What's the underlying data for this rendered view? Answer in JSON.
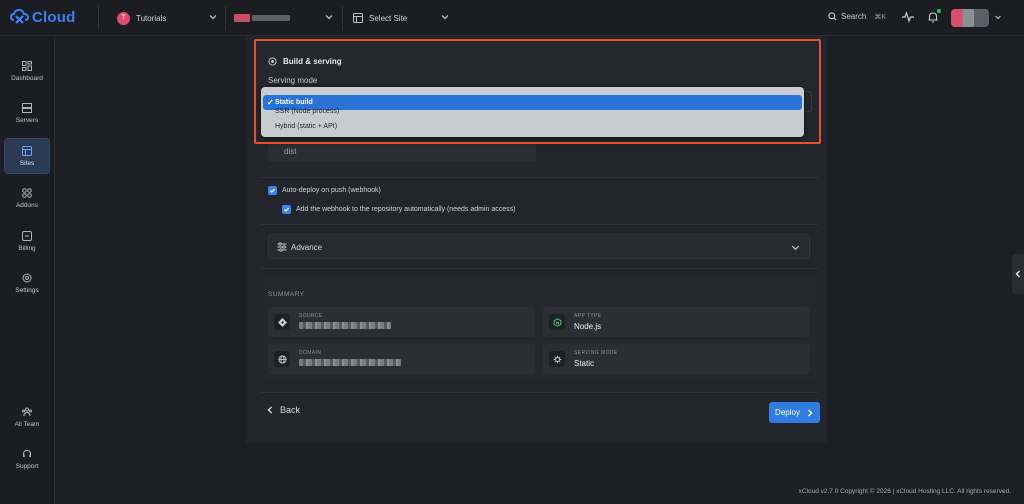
{
  "app": {
    "name": "Cloud",
    "logo_icon": "xcloud-logo-icon"
  },
  "topbar": {
    "team_select": {
      "badge": "T",
      "label": "Tutorials"
    },
    "server_select": {
      "label": ""
    },
    "site_select": {
      "label": "Select Site"
    },
    "search": {
      "label": "Search",
      "shortcut": "⌘K"
    }
  },
  "sidebar": {
    "items": [
      {
        "label": "Dashboard",
        "icon": "dashboard-icon",
        "active": false
      },
      {
        "label": "Servers",
        "icon": "servers-icon",
        "active": false
      },
      {
        "label": "Sites",
        "icon": "sites-icon",
        "active": true
      },
      {
        "label": "Addons",
        "icon": "addons-icon",
        "active": false
      },
      {
        "label": "Billing",
        "icon": "billing-icon",
        "active": false
      },
      {
        "label": "Settings",
        "icon": "settings-icon",
        "active": false
      }
    ],
    "bottom_items": [
      {
        "label": "All Team",
        "icon": "team-icon"
      },
      {
        "label": "Support",
        "icon": "headset-icon"
      }
    ]
  },
  "build": {
    "title": "Build & serving",
    "serving_mode_label": "Serving mode",
    "serving_mode_options": [
      "Static build",
      "SSR (Node process)",
      "Hybrid (static + API)"
    ],
    "serving_mode_selected": "Static build",
    "output_dir_value": "dist"
  },
  "options": {
    "auto_deploy_label": "Auto-deploy on push (webhook)",
    "auto_deploy_checked": true,
    "add_webhook_label": "Add the webhook to the repository automatically (needs admin access)",
    "add_webhook_checked": true,
    "advance_label": "Advance"
  },
  "summary": {
    "title": "SUMMARY",
    "source": {
      "key": "SOURCE",
      "value": ""
    },
    "app_type": {
      "key": "APP TYPE",
      "value": "Node.js"
    },
    "domain": {
      "key": "DOMAIN",
      "value": ""
    },
    "serving_mode": {
      "key": "SERVING MODE",
      "value": "Static"
    }
  },
  "actions": {
    "back_label": "Back",
    "deploy_label": "Deploy"
  },
  "footer": {
    "text": "xCloud v2.7.0 Copyright © 2026 | xCloud Hosting LLC. All rights reserved."
  },
  "colors": {
    "accent": "#2f7de1",
    "highlight": "#e5502e",
    "brand": "#3b82f6"
  }
}
